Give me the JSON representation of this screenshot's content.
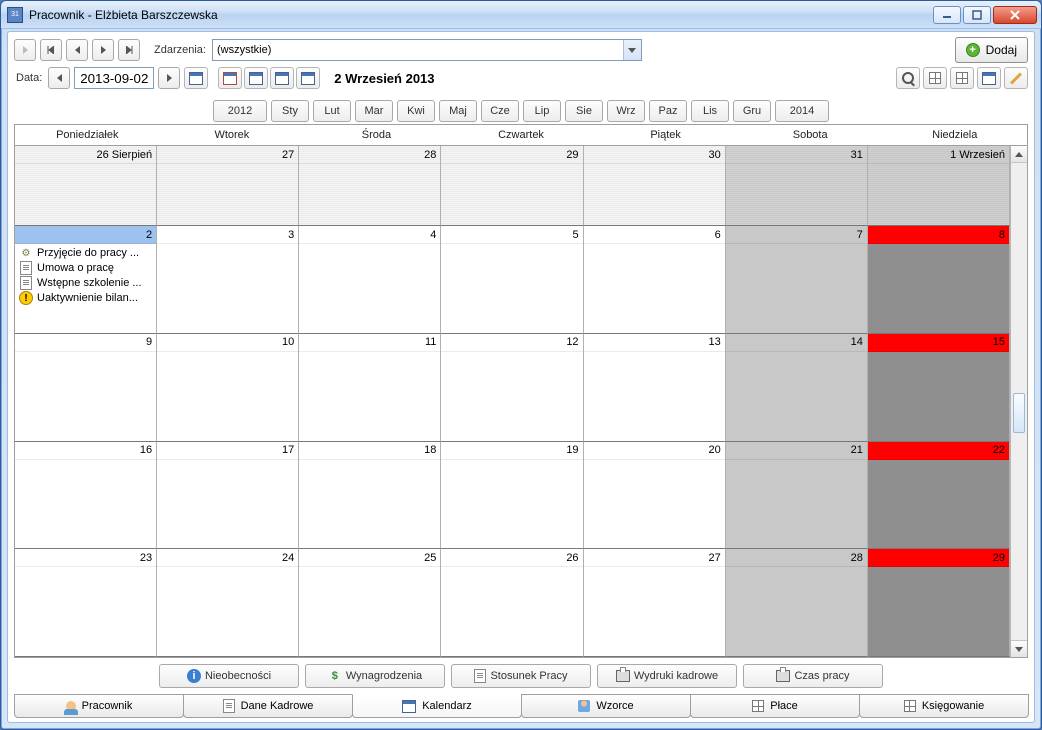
{
  "window": {
    "title": "Pracownik - Elżbieta Barszczewska"
  },
  "toolbar": {
    "events_label": "Zdarzenia:",
    "filter_value": "(wszystkie)",
    "add_label": "Dodaj"
  },
  "datebar": {
    "label": "Data:",
    "value": "2013-09-02",
    "current_date_display": "2 Wrzesień 2013"
  },
  "month_nav": {
    "prev_year": "2012",
    "months": [
      "Sty",
      "Lut",
      "Mar",
      "Kwi",
      "Maj",
      "Cze",
      "Lip",
      "Sie",
      "Wrz",
      "Paz",
      "Lis",
      "Gru"
    ],
    "next_year": "2014"
  },
  "weekdays": [
    "Poniedziałek",
    "Wtorek",
    "Środa",
    "Czwartek",
    "Piątek",
    "Sobota",
    "Niedziela"
  ],
  "first_row_labels": [
    "26 Sierpień",
    "27",
    "28",
    "29",
    "30",
    "31",
    "1 Wrzesień"
  ],
  "weeks": [
    [
      "2",
      "3",
      "4",
      "5",
      "6",
      "7",
      "8"
    ],
    [
      "9",
      "10",
      "11",
      "12",
      "13",
      "14",
      "15"
    ],
    [
      "16",
      "17",
      "18",
      "19",
      "20",
      "21",
      "22"
    ],
    [
      "23",
      "24",
      "25",
      "26",
      "27",
      "28",
      "29"
    ]
  ],
  "day2_events": [
    "Przyjęcie do pracy ...",
    "Umowa o pracę",
    "Wstępne szkolenie ...",
    "Uaktywnienie bilan..."
  ],
  "action_buttons": [
    "Nieobecności",
    "Wynagrodzenia",
    "Stosunek Pracy",
    "Wydruki kadrowe",
    "Czas pracy"
  ],
  "tabs": [
    "Pracownik",
    "Dane Kadrowe",
    "Kalendarz",
    "Wzorce",
    "Płace",
    "Księgowanie"
  ]
}
